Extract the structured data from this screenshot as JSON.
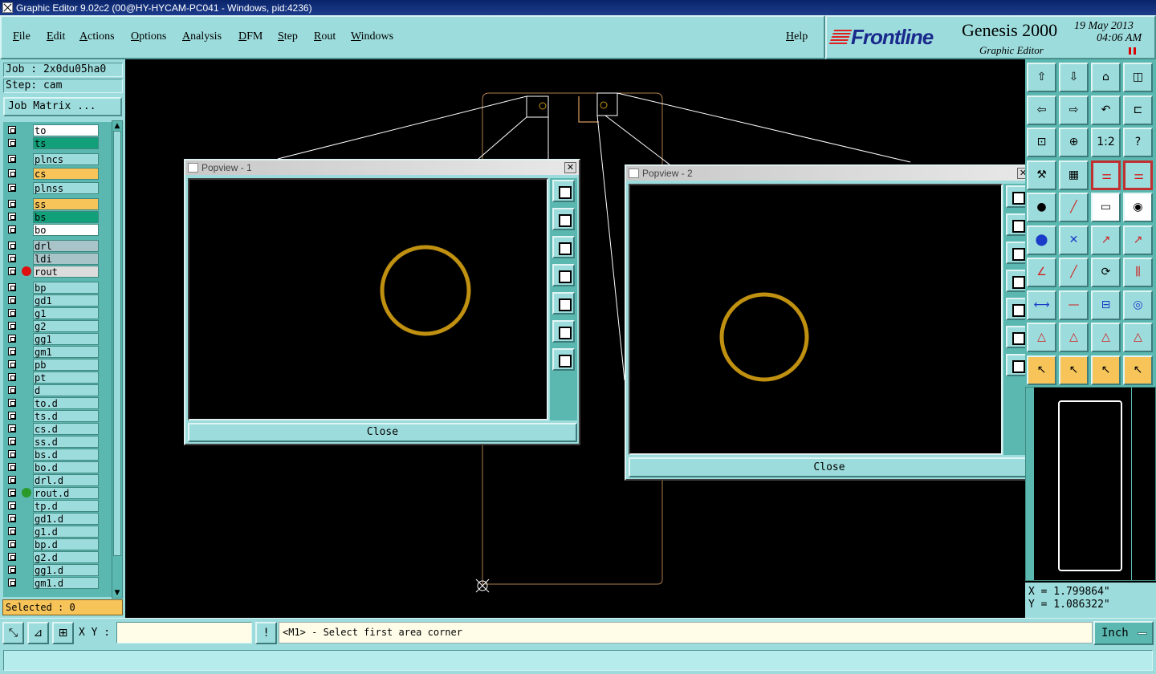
{
  "window": {
    "title": "Graphic Editor 9.02c2 (00@HY-HYCAM-PC041 - Windows, pid:4236)"
  },
  "menu": [
    "File",
    "Edit",
    "Actions",
    "Options",
    "Analysis",
    "DFM",
    "Step",
    "Rout",
    "Windows"
  ],
  "help_label": "Help",
  "logo": {
    "brand": "Frontline",
    "product": "Genesis 2000",
    "subtitle": "Graphic Editor",
    "date": "19 May 2013",
    "time": "04:06 AM"
  },
  "job": "Job : 2x0du05ha0",
  "step": "Step: cam",
  "job_matrix_label": "Job Matrix ...",
  "layers": [
    {
      "name": "to",
      "color": "#ffffff"
    },
    {
      "name": "ts",
      "color": "#12a07a"
    },
    {
      "name": "plncs",
      "color": "#9ddcdc"
    },
    {
      "name": "cs",
      "color": "#f7c45a"
    },
    {
      "name": "plnss",
      "color": "#9ddcdc"
    },
    {
      "name": "ss",
      "color": "#f7c45a"
    },
    {
      "name": "bs",
      "color": "#12a07a"
    },
    {
      "name": "bo",
      "color": "#ffffff"
    },
    {
      "name": "drl",
      "color": "#a8c4c8"
    },
    {
      "name": "ldi",
      "color": "#a8c4c8"
    },
    {
      "name": "rout",
      "color": "#dcdcdc",
      "dot": "#e01010"
    },
    {
      "name": "bp",
      "color": "#9ddcdc"
    },
    {
      "name": "gd1",
      "color": "#9ddcdc"
    },
    {
      "name": "g1",
      "color": "#9ddcdc"
    },
    {
      "name": "g2",
      "color": "#9ddcdc"
    },
    {
      "name": "gg1",
      "color": "#9ddcdc"
    },
    {
      "name": "gm1",
      "color": "#9ddcdc"
    },
    {
      "name": "pb",
      "color": "#9ddcdc"
    },
    {
      "name": "pt",
      "color": "#9ddcdc"
    },
    {
      "name": "d",
      "color": "#9ddcdc"
    },
    {
      "name": "to.d",
      "color": "#9ddcdc"
    },
    {
      "name": "ts.d",
      "color": "#9ddcdc"
    },
    {
      "name": "cs.d",
      "color": "#9ddcdc"
    },
    {
      "name": "ss.d",
      "color": "#9ddcdc"
    },
    {
      "name": "bs.d",
      "color": "#9ddcdc"
    },
    {
      "name": "bo.d",
      "color": "#9ddcdc"
    },
    {
      "name": "drl.d",
      "color": "#9ddcdc"
    },
    {
      "name": "rout.d",
      "color": "#9ddcdc",
      "dot": "#2a9a2a"
    },
    {
      "name": "tp.d",
      "color": "#9ddcdc"
    },
    {
      "name": "gd1.d",
      "color": "#9ddcdc"
    },
    {
      "name": "g1.d",
      "color": "#9ddcdc"
    },
    {
      "name": "bp.d",
      "color": "#9ddcdc"
    },
    {
      "name": "g2.d",
      "color": "#9ddcdc"
    },
    {
      "name": "gg1.d",
      "color": "#9ddcdc"
    },
    {
      "name": "gm1.d",
      "color": "#9ddcdc"
    }
  ],
  "selected": "Selected : 0",
  "popview1": {
    "title": "Popview - 1",
    "close_label": "Close"
  },
  "popview2": {
    "title": "Popview - 2",
    "close_label": "Close"
  },
  "coords": {
    "x": "X = 1.799864\"",
    "y": "Y = 1.086322\""
  },
  "xy_label": "X Y :",
  "xy_input_value": "",
  "prompt": "<M1> - Select first area corner",
  "units": "Inch",
  "toolbar_icons": [
    "move-up-icon",
    "move-down-icon",
    "home-icon",
    "split-view-icon",
    "move-left-icon",
    "move-right-icon",
    "undo-icon",
    "snap-icon",
    "fit-icon",
    "center-icon",
    "zoom-1-2-icon",
    "help-icon",
    "tools-icon",
    "grid-icon",
    "layers-icon",
    "layers-alt-icon",
    "pad-icon",
    "line-icon",
    "ruler-icon",
    "pad-fill-icon",
    "net-icon",
    "cross-icon",
    "point-icon",
    "point-alt-icon",
    "angle-icon",
    "slash-icon",
    "arc-icon",
    "mirror-icon",
    "measure-icon",
    "segment-icon",
    "dimension-icon",
    "shape-icon",
    "triangle-icon",
    "triangle-alt-icon",
    "triangle-up-icon",
    "triangle-down-icon",
    "select-icon",
    "select-frame-icon",
    "select-alt-icon",
    "select-multi-icon"
  ],
  "colors": {
    "panel": "#9ddcdc",
    "panel_dark": "#5ab8b0",
    "board_outline": "#b08050",
    "pad_ring": "#c09010"
  }
}
